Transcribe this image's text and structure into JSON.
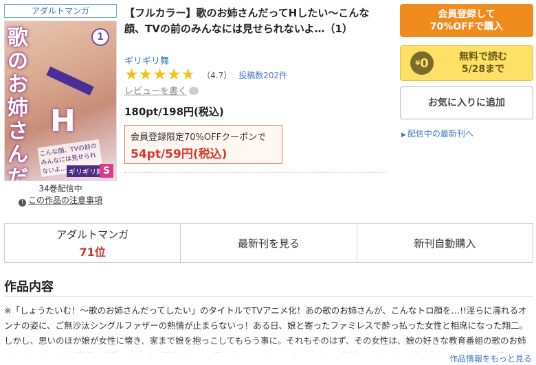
{
  "category_tag": "アダルトマンガ",
  "cover": {
    "volume_badge": "1",
    "title_art": "歌のお姉さんだってHしたい",
    "h_art": "H",
    "tagline": "こんな顔、TVの前のみんなには見せられないよ…",
    "author_art": "ギリギリ舞",
    "publisher_logo": "S"
  },
  "volumes_text": "34巻配信中",
  "caution": {
    "icon": "info-icon",
    "text": "この作品の注意事項"
  },
  "title": "【フルカラー】歌のお姉さんだってHしたい〜こんな顔、TVの前のみんなには見せられないよ…（1）",
  "author": "ギリギリ舞",
  "rating": {
    "stars": 4.7,
    "value_text": "（4.7）",
    "review_count": "投稿数202件"
  },
  "write_review": "レビューを書く",
  "price": "180pt/198円(税込)",
  "coupon": {
    "label": "会員登録限定70%OFFクーポンで",
    "price": "54pt/59円(税込)"
  },
  "buttons": {
    "register_line1": "会員登録して",
    "register_line2": "70%OFFで購入",
    "free_badge_yen": "¥",
    "free_badge_zero": "0",
    "free_line1": "無料で読む",
    "free_line2": "5/28まで",
    "favorite": "お気に入りに追加"
  },
  "latest_link": "配信中の最新刊へ",
  "tabs": {
    "ranking_label": "アダルトマンガ",
    "ranking_value": "71位",
    "latest": "最新刊を見る",
    "auto_purchase": "新刊自動購入"
  },
  "section_heading": "作品内容",
  "synopsis": "※「しょうたいむ！〜歌のお姉さんだってしたい」のタイトルでTVアニメ化！あの歌のお姉さんが、こんなトロ顔を…!!淫らに濡れるオンナの姿に、ご無沙汰シングルファザーの熱情が止まらないっ！ある日、娘と寄ったファミレスで酔っ払った女性と相席になった翔二。しかし、思いのほか娘が女性に懐き、家まで娘を抱っこしてもらう事に。それもそのはず、その女性は、娘の好きな教育番組の歌のお姉さんだったのだ!仕事柄、恋愛も出来ず、孤独からヤケ酒を飲んでいたというお姉さん。異性と二人きりで過ごす久々の時間に、互いに胸が高まる。唇が触れ、手",
  "more_info": "作品情報をもっと見る",
  "colors": {
    "accent_orange": "#f08c1e",
    "free_yellow": "#fde066",
    "link_blue": "#3a79c4",
    "price_red": "#d9382c",
    "star_gold": "#f0c419"
  }
}
